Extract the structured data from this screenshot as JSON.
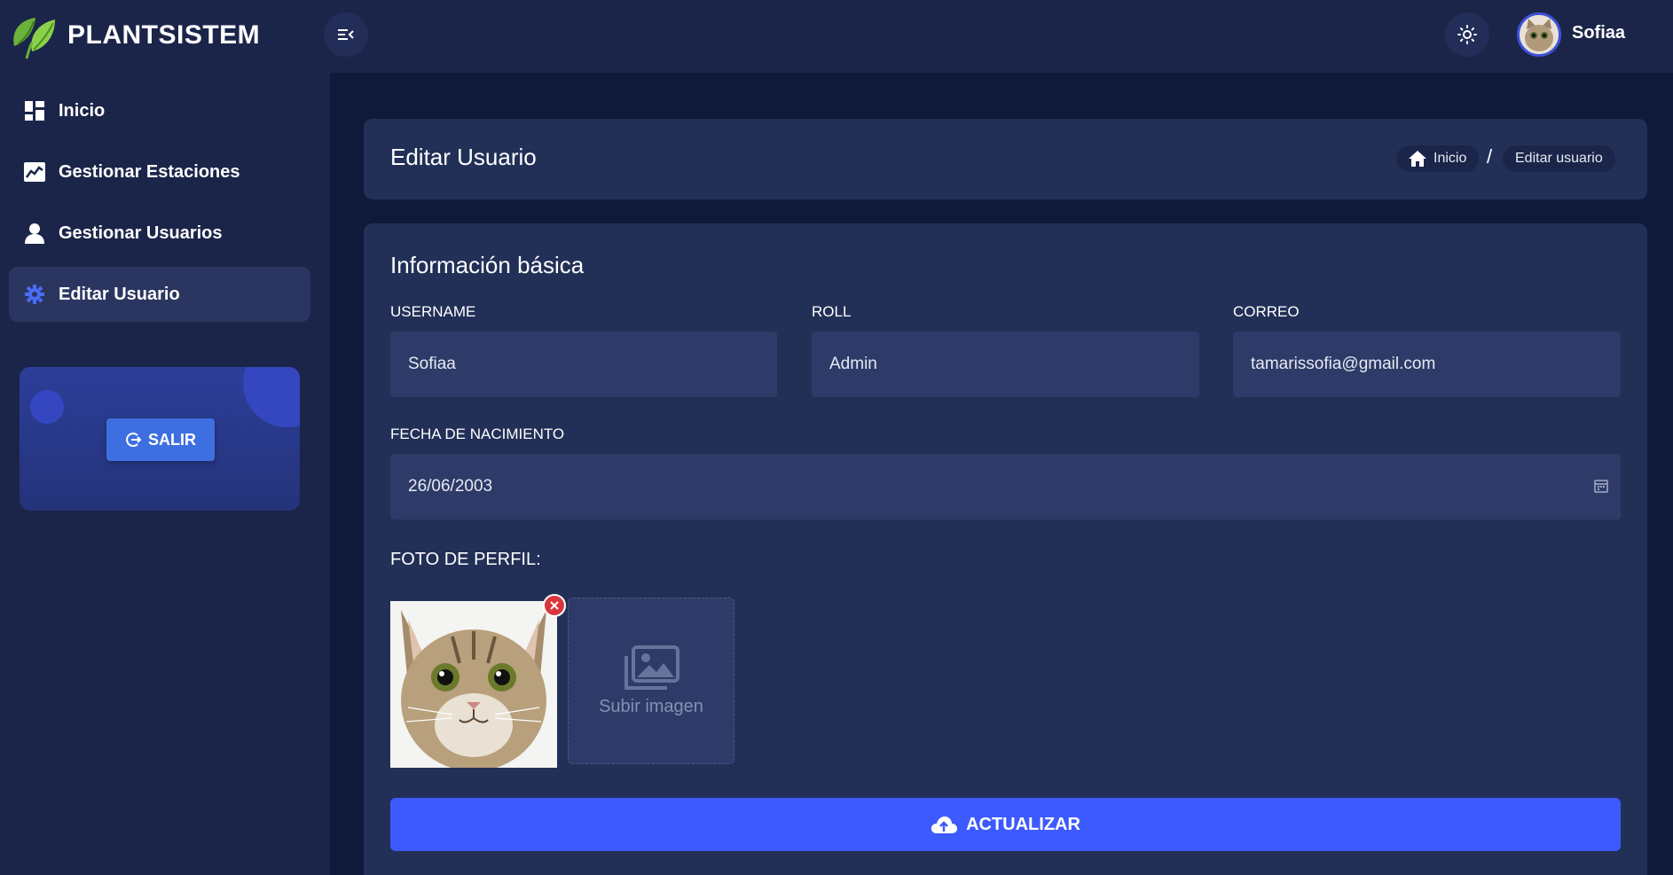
{
  "brand": {
    "name": "PLANTSISTEM"
  },
  "user": {
    "name": "Sofiaa"
  },
  "sidebar": {
    "items": [
      {
        "label": "Inicio",
        "icon": "dashboard-icon"
      },
      {
        "label": "Gestionar Estaciones",
        "icon": "chart-icon"
      },
      {
        "label": "Gestionar Usuarios",
        "icon": "user-icon"
      },
      {
        "label": "Editar Usuario",
        "icon": "gear-icon",
        "active": true
      }
    ],
    "logout_label": "SALIR"
  },
  "header": {
    "title": "Editar Usuario",
    "breadcrumb": {
      "home": "Inicio",
      "separator": "/",
      "current": "Editar usuario"
    }
  },
  "form": {
    "section_title": "Información básica",
    "fields": {
      "username": {
        "label": "USERNAME",
        "value": "Sofiaa"
      },
      "roll": {
        "label": "ROLL",
        "value": "Admin"
      },
      "correo": {
        "label": "CORREO",
        "value": "tamarissofia@gmail.com"
      },
      "fecha": {
        "label": "FECHA DE NACIMIENTO",
        "value": "26/06/2003"
      }
    },
    "photo": {
      "label": "FOTO DE PERFIL:",
      "upload_text": "Subir imagen"
    },
    "submit_label": "ACTUALIZAR"
  },
  "colors": {
    "background": "#0f1a3a",
    "panel": "#1b2549",
    "card": "#223057",
    "input": "#2e3b68",
    "accent": "#3d5afe",
    "danger": "#d9363e",
    "brand_green": "#7cc242"
  }
}
